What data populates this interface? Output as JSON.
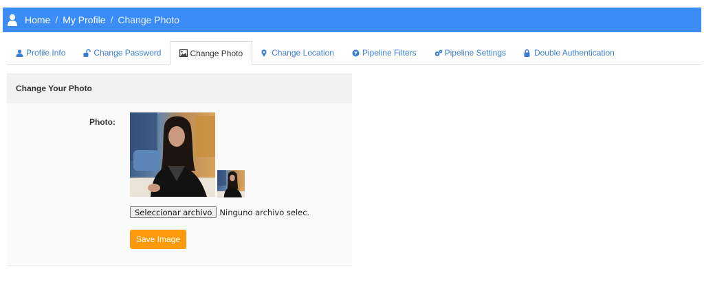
{
  "breadcrumb": {
    "items": [
      "Home",
      "My Profile",
      "Change Photo"
    ],
    "separator": "/"
  },
  "tabs": [
    {
      "label": "Profile Info",
      "icon": "user-icon",
      "active": false
    },
    {
      "label": "Change Password",
      "icon": "unlock-icon",
      "active": false
    },
    {
      "label": "Change Photo",
      "icon": "image-icon",
      "active": true
    },
    {
      "label": "Change Location",
      "icon": "map-marker-icon",
      "active": false
    },
    {
      "label": "Pipeline Filters",
      "icon": "filter-icon",
      "active": false
    },
    {
      "label": "Pipeline Settings",
      "icon": "gears-icon",
      "active": false
    },
    {
      "label": "Double Authentication",
      "icon": "lock-icon",
      "active": false
    }
  ],
  "panel": {
    "title": "Change Your Photo",
    "photo_label": "Photo:",
    "file_button_label": "Seleccionar archivo",
    "file_status": "Ninguno archivo selec.",
    "save_label": "Save Image"
  },
  "colors": {
    "header_bg": "#3b8cf5",
    "tab_link": "#3b7ed1",
    "save_button": "#fd9a0b"
  }
}
